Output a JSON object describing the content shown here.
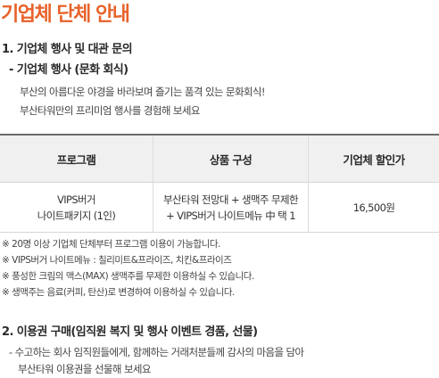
{
  "page_title": "기업체 단체 안내",
  "section1": {
    "heading": "1. 기업체 행사 및 대관 문의",
    "sub_heading": "- 기업체 행사 (문화 회식)",
    "lines": [
      "부산의 아름다운 야경을 바라보며 즐기는 품격 있는 문화회식!",
      "부산타워만의 프리미엄 행사를 경험해 보세요"
    ]
  },
  "table": {
    "headers": [
      "프로그램",
      "상품 구성",
      "기업체 할인가"
    ],
    "rows": [
      {
        "program": [
          "VIPS버거",
          "나이트패키지 (1인)"
        ],
        "composition": [
          "부산타워 전망대 + 생맥주 무제한",
          "+ VIPS버거 나이트메뉴 中 택 1"
        ],
        "price": "16,500원"
      }
    ]
  },
  "notes": [
    "※ 20명 이상 기업체 단체부터 프로그램 이용이 가능합니다.",
    "※ VIPS버거 나이트메뉴 : 칠리미트&프라이즈, 치킨&프라이즈",
    "※ 풍성한 크림의 맥스(MAX) 생맥주를 무제한 이용하실 수 있습니다.",
    "※ 생맥주는 음료(커피, 탄산)로 변경하여 이용하실 수 있습니다."
  ],
  "section2": {
    "heading": "2. 이용권 구매(임직원 복지 및 행사 이벤트 경품, 선물)",
    "lines": [
      "- 수고하는 회사 임직원들에게, 함께하는 거래처분들께 감사의 마음을 담아",
      "부산타워 이용권을 선물해 보세요"
    ]
  },
  "colors": {
    "title": "#e8622a",
    "table_header_bg": "#f0f0f0",
    "table_top_border": "#6b6b6b"
  }
}
